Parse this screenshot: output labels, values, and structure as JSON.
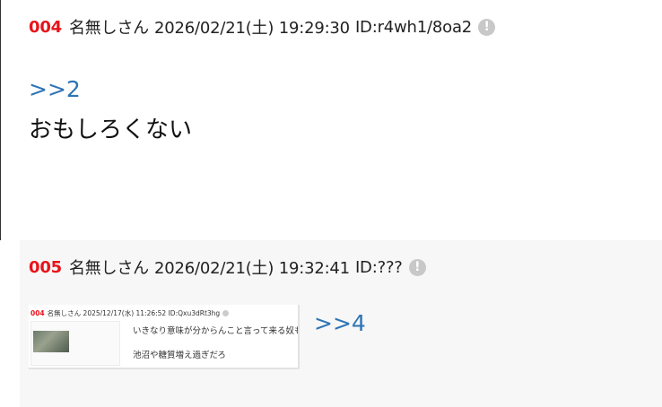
{
  "posts": [
    {
      "number": "004",
      "name": "名無しさん",
      "date": "2026/02/21(土) 19:29:30",
      "id": "ID:r4wh1/8oa2",
      "anchor": ">>2",
      "body": "おもしろくない",
      "info_icon": "exclamation-circle"
    },
    {
      "number": "005",
      "name": "名無しさん",
      "date": "2026/02/21(土) 19:32:41",
      "id": "ID:???",
      "anchor": ">>4",
      "info_icon": "exclamation-circle",
      "image": {
        "header_number": "004",
        "header_name": "名無しさん",
        "header_date": "2025/12/17(水) 11:26:52",
        "header_id": "ID:Qxu3dRt3hg",
        "line1": "いきなり意味が分からんこと言って来る奴も怖い",
        "line2": "池沼や糖質増え過ぎだろ"
      }
    }
  ],
  "colors": {
    "post_number": "#e8141b",
    "anchor_link": "#2e74b5",
    "post_bg_alt": "#f7f7f7"
  }
}
